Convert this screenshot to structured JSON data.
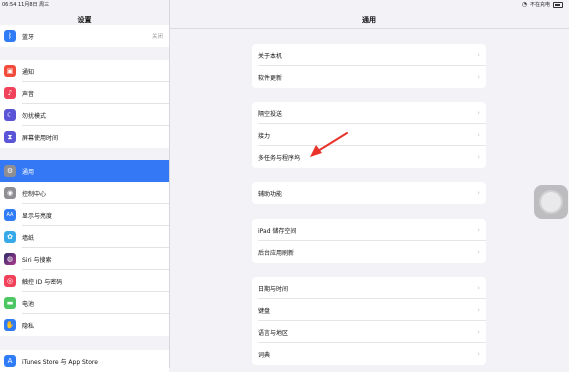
{
  "status": {
    "time": "06:54  11月8日 周三",
    "charging": "不在充电"
  },
  "sidebar": {
    "title": "设置",
    "groups": [
      {
        "items": [
          {
            "label": "蓝牙",
            "value": "关闭",
            "icon": "bluetooth-icon",
            "color": "#2f7cf6"
          }
        ]
      },
      {
        "items": [
          {
            "label": "通知",
            "icon": "notification-icon",
            "color": "#f24b3a"
          },
          {
            "label": "声音",
            "icon": "sound-icon",
            "color": "#f2425a"
          },
          {
            "label": "勿扰模式",
            "icon": "moon-icon",
            "color": "#5a55d6"
          },
          {
            "label": "屏幕使用时间",
            "icon": "hourglass-icon",
            "color": "#5a55d6"
          }
        ]
      },
      {
        "items": [
          {
            "label": "通用",
            "icon": "gear-icon",
            "color": "#8e8e93",
            "selected": true
          },
          {
            "label": "控制中心",
            "icon": "control-center-icon",
            "color": "#8e8e93"
          },
          {
            "label": "显示与亮度",
            "icon": "display-icon",
            "color": "#2f7cf6"
          },
          {
            "label": "墙纸",
            "icon": "wallpaper-icon",
            "color": "#37a9e8"
          },
          {
            "label": "Siri 与搜索",
            "icon": "siri-icon",
            "color": "#222222"
          },
          {
            "label": "触控 ID 与密码",
            "icon": "fingerprint-icon",
            "color": "#f2425a"
          },
          {
            "label": "电池",
            "icon": "battery-icon",
            "color": "#4cc764"
          },
          {
            "label": "隐私",
            "icon": "hand-icon",
            "color": "#2f7cf6"
          }
        ]
      },
      {
        "items": [
          {
            "label": "iTunes Store 与 App Store",
            "icon": "appstore-icon",
            "color": "#2f7cf6"
          }
        ]
      }
    ]
  },
  "main": {
    "title": "通用",
    "groups": [
      [
        "关于本机",
        "软件更新"
      ],
      [
        "隔空投送",
        "接力",
        "多任务与程序坞"
      ],
      [
        "辅助功能"
      ],
      [
        "iPad 储存空间",
        "后台应用刷新"
      ],
      [
        "日期与时间",
        "键盘",
        "语言与地区",
        "词典"
      ]
    ]
  },
  "colors": {
    "accent": "#3478f6",
    "annotation": "#e8322a"
  }
}
